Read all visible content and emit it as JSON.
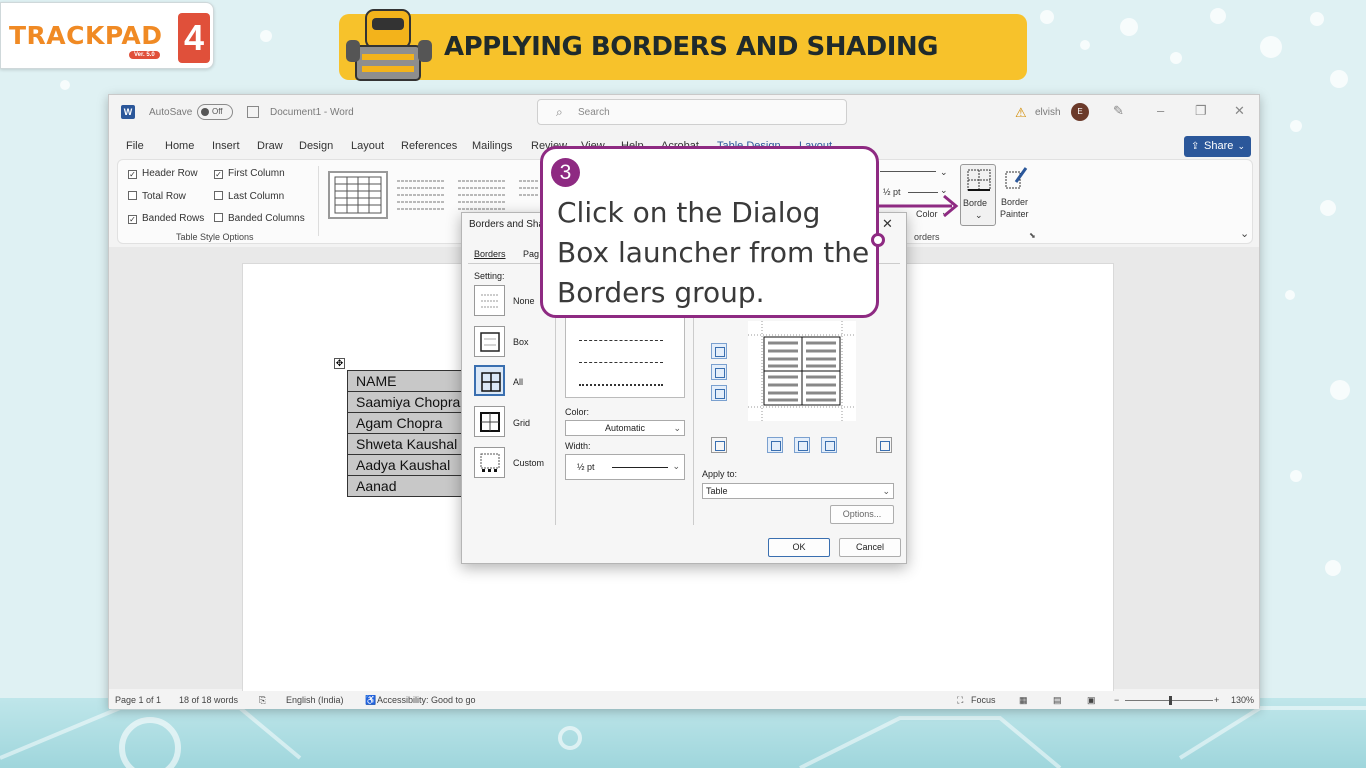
{
  "brand": {
    "name": "TRACKPAD",
    "version": "Ver. 5.0",
    "number": "4"
  },
  "banner": {
    "title": "APPLYING BORDERS AND SHADING"
  },
  "colors": {
    "accent_purple": "#8e2a82",
    "banner_yellow": "#f7c22b",
    "word_blue": "#2b579a"
  },
  "word": {
    "autosave_label": "AutoSave",
    "autosave_state": "Off",
    "doc_title": "Document1 - Word",
    "search_placeholder": "Search",
    "user_name": "elvish",
    "avatar_initial": "E",
    "menu": [
      "File",
      "Home",
      "Insert",
      "Draw",
      "Design",
      "Layout",
      "References",
      "Mailings",
      "Review",
      "View",
      "Help",
      "Acrobat",
      "Table Design",
      "Layout"
    ],
    "share_label": "Share",
    "ribbon": {
      "header_row": "Header Row",
      "first_column": "First Column",
      "total_row": "Total Row",
      "last_column": "Last Column",
      "banded_rows": "Banded Rows",
      "banded_columns": "Banded Columns",
      "group_label": "Table Style Options",
      "pen_weight": "½ pt",
      "pen_color": "Color",
      "borders_label": "Borde",
      "border_painter_1": "Border",
      "border_painter_2": "Painter",
      "borders_group_label": "orders"
    },
    "table_rows": [
      "NAME",
      "Saamiya Chopra",
      "Agam Chopra",
      "Shweta Kaushal",
      "Aadya Kaushal",
      "Aanad"
    ],
    "status": {
      "page": "Page 1 of 1",
      "words": "18 of 18 words",
      "language": "English (India)",
      "accessibility": "Accessibility: Good to go",
      "focus": "Focus",
      "zoom": "130%"
    }
  },
  "dialog": {
    "title": "Borders and Sha",
    "tabs": [
      "Borders",
      "Pag"
    ],
    "setting_label": "Setting:",
    "settings": [
      "None",
      "Box",
      "All",
      "Grid",
      "Custom"
    ],
    "color_label": "Color:",
    "color_value": "Automatic",
    "width_label": "Width:",
    "width_value": "½ pt",
    "apply_to_label": "Apply to:",
    "apply_to_value": "Table",
    "options_button": "Options...",
    "ok_button": "OK",
    "cancel_button": "Cancel"
  },
  "callout": {
    "step": "3",
    "text": "Click on the Dialog Box launcher from the Borders group."
  }
}
